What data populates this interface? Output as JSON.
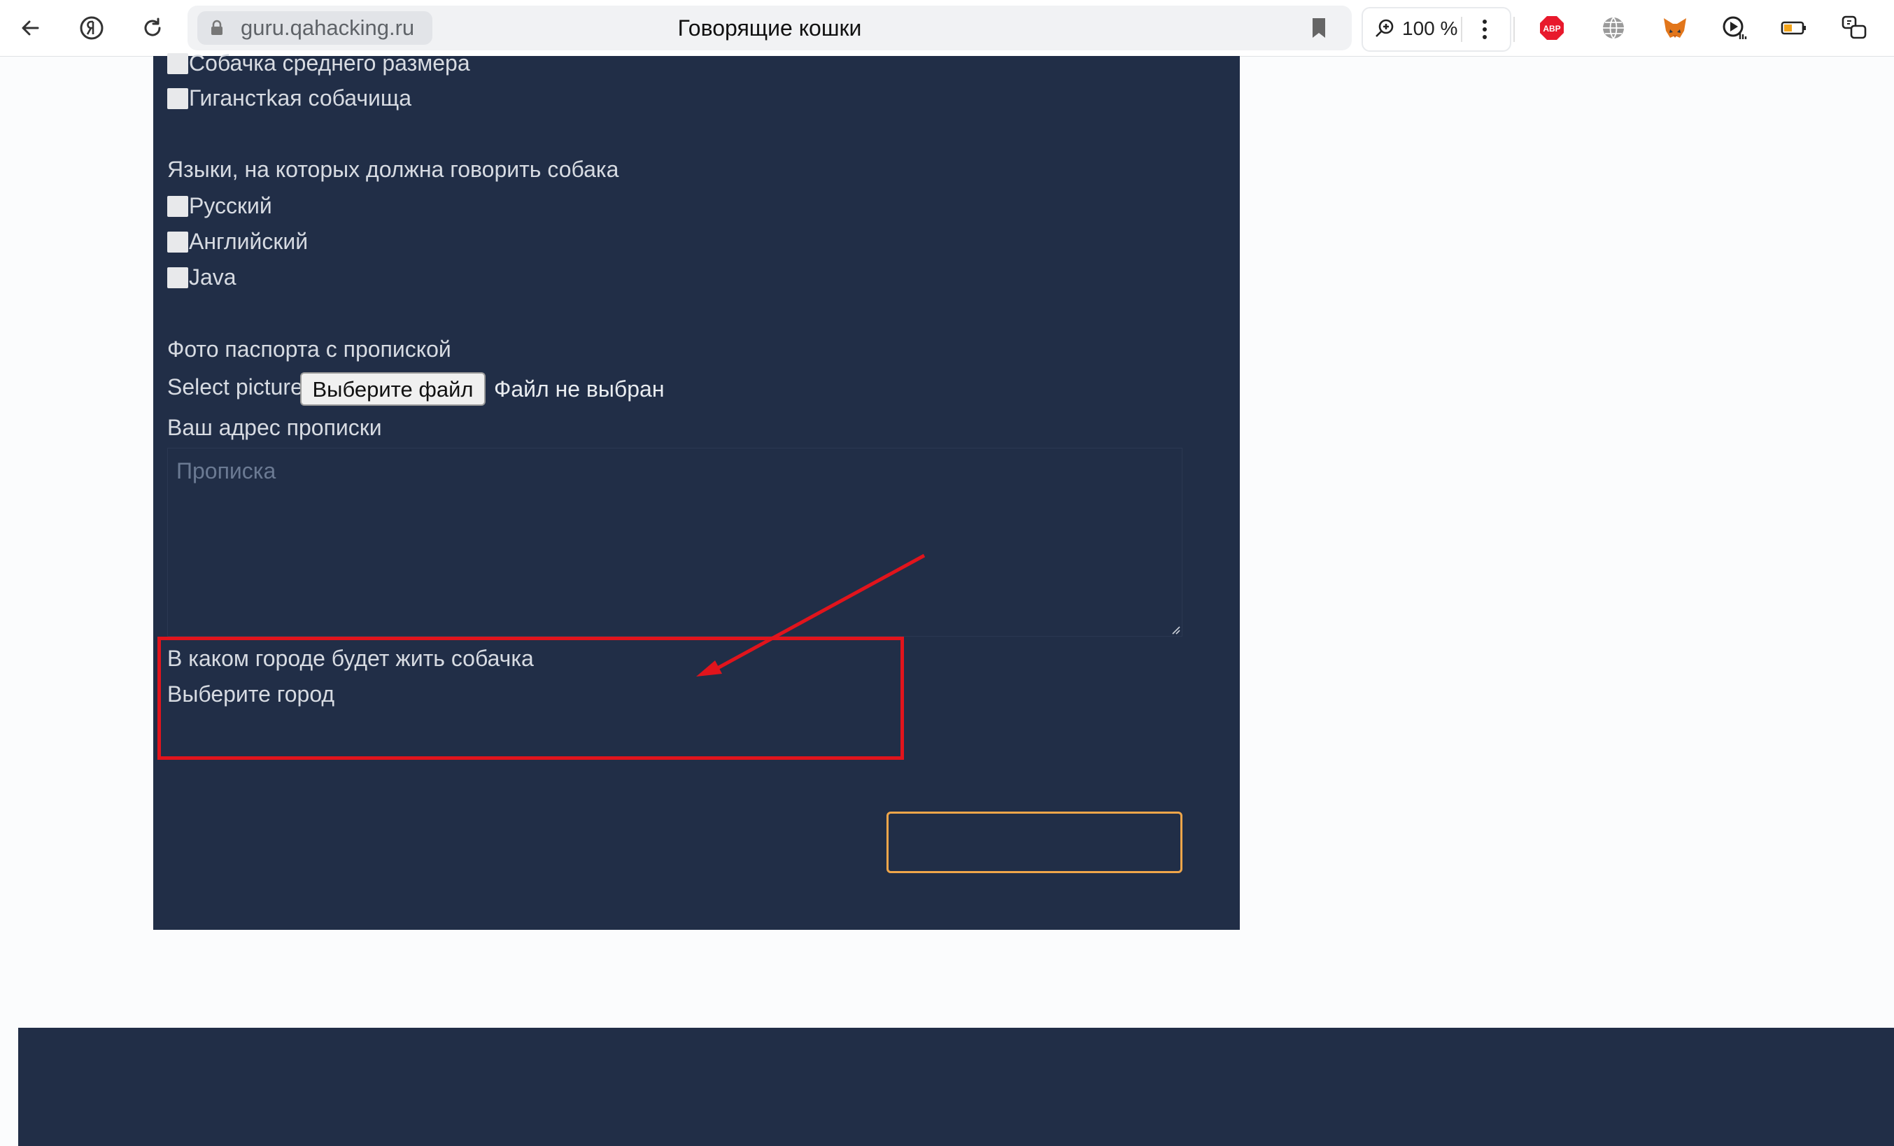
{
  "browser": {
    "host": "guru.qahacking.ru",
    "page_title": "Говорящие кошки",
    "zoom": "100 %",
    "icons": [
      "back-arrow-icon",
      "yandex-icon",
      "reload-icon",
      "lock-icon",
      "bookmark-icon",
      "zoom-icon",
      "menu-dots-icon",
      "adblock-icon",
      "globe-icon",
      "metamask-icon",
      "media-icon",
      "battery-icon",
      "chat-icon"
    ],
    "adblock_label": "ABP"
  },
  "form": {
    "size_options": [
      "Собачка среднего размера",
      "Гиганстkая собачища"
    ],
    "languages_label": "Языки, на которых должна говорить собака",
    "languages": [
      "Русский",
      "Английский",
      "Java"
    ],
    "passport_label": "Фото паспорта с пропиской",
    "select_picture_label": "Select picture",
    "file_button": "Выберите файл",
    "file_status": "Файл не выбран",
    "address_label": "Ваш адрес прописки",
    "address_placeholder": "Прописка",
    "city_question": "В каком городе будет жить собачка",
    "city_select_label": "Выберите город"
  },
  "colors": {
    "panel": "#212e47",
    "highlight": "#e1141c",
    "button_border": "#f0a64a"
  }
}
